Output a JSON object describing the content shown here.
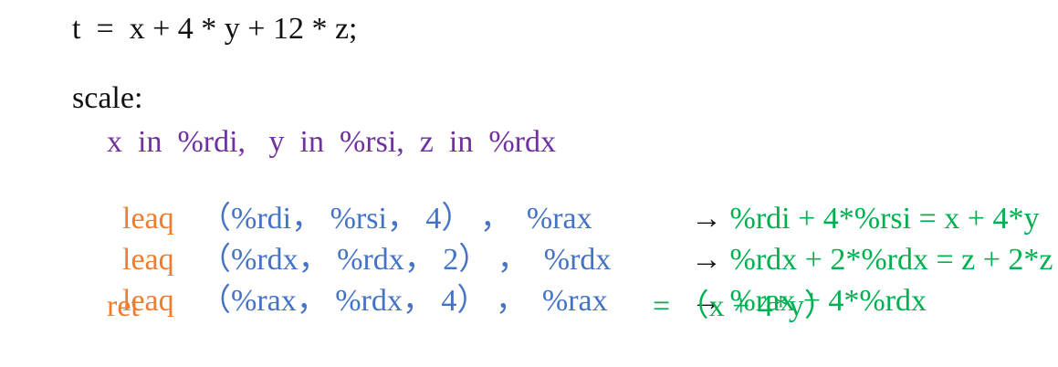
{
  "expression": "t  =  x + 4 * y + 12 * z;",
  "label": "scale:",
  "registers": "x  in  %rdi,   y  in  %rsi,  z  in  %rdx",
  "instructions": [
    {
      "op": "leaq",
      "args": "（%rdi， %rsi， 4） ，  %rax",
      "arrow": "→",
      "result": "%rdi + 4*%rsi = x + 4*y"
    },
    {
      "op": "leaq",
      "args": "（%rdx， %rdx， 2） ，  %rdx",
      "arrow": "→",
      "result": "%rdx + 2*%rdx = z + 2*z"
    },
    {
      "op": "leaq",
      "args": "（%rax， %rdx， 4） ，  %rax",
      "arrow": "→",
      "result": "%rax + 4*%rdx"
    },
    {
      "op": "ret",
      "args": "",
      "arrow": "",
      "result": "= （x + 4*y）"
    }
  ],
  "colors": {
    "text": "#111111",
    "registers": "#7030a0",
    "opcode": "#ed7d31",
    "operands": "#4472c4",
    "result": "#00b050"
  }
}
